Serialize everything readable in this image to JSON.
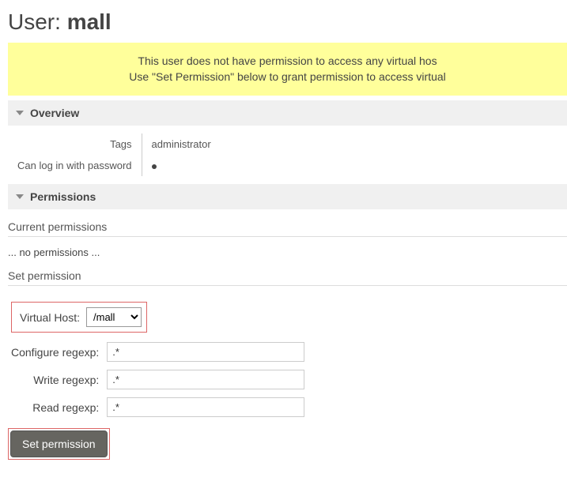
{
  "page_title_prefix": "User: ",
  "page_title_value": "mall",
  "warning_line1": "This user does not have permission to access any virtual hos",
  "warning_line2": "Use \"Set Permission\" below to grant permission to access virtual",
  "overview": {
    "header": "Overview",
    "tags_label": "Tags",
    "tags_value": "administrator",
    "login_label": "Can log in with password"
  },
  "permissions": {
    "header": "Permissions",
    "current_heading": "Current permissions",
    "no_permissions": "... no permissions ...",
    "set_heading": "Set permission",
    "form": {
      "vhost_label": "Virtual Host:",
      "vhost_value": "/mall",
      "configure_label": "Configure regexp:",
      "configure_value": ".*",
      "write_label": "Write regexp:",
      "write_value": ".*",
      "read_label": "Read regexp:",
      "read_value": ".*",
      "submit_label": "Set permission"
    }
  }
}
